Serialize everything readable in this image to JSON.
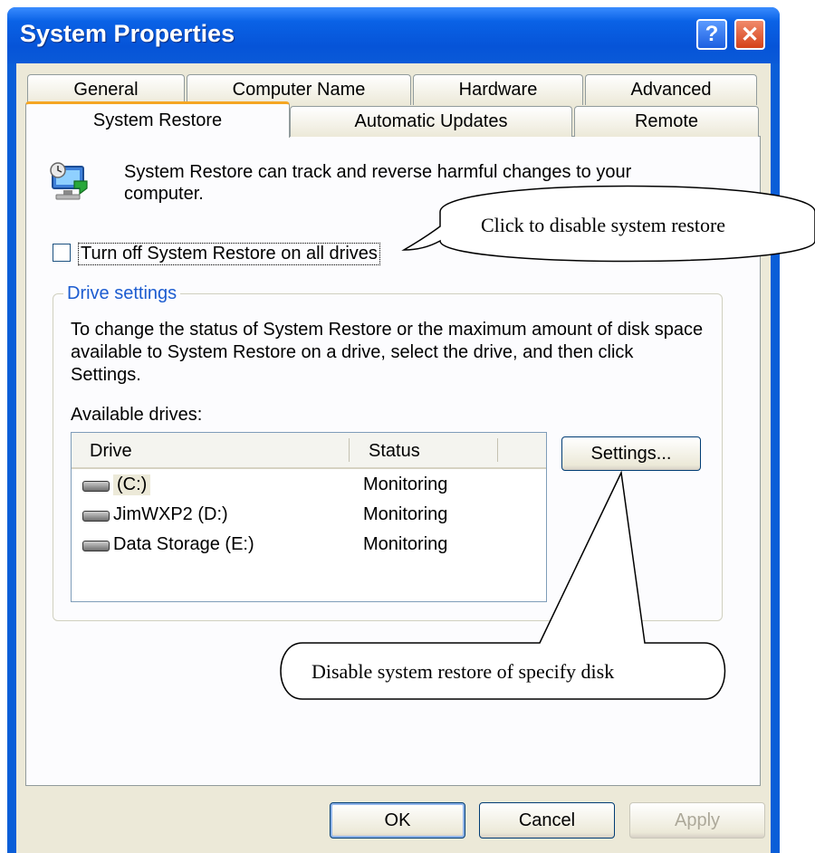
{
  "window": {
    "title": "System Properties",
    "help_glyph": "?",
    "close_glyph": "✕"
  },
  "tabs_row1": [
    "General",
    "Computer Name",
    "Hardware",
    "Advanced"
  ],
  "tabs_row2": [
    "System Restore",
    "Automatic Updates",
    "Remote"
  ],
  "active_tab": "System Restore",
  "intro_text": "System Restore can track and reverse harmful changes to your computer.",
  "turn_off_checkbox": {
    "label": "Turn off System Restore on all drives",
    "checked": false
  },
  "drive_settings": {
    "group_label": "Drive settings",
    "description": "To change the status of System Restore or the maximum amount of disk space available to System Restore on a drive, select the drive, and then click Settings.",
    "available_label": "Available drives:",
    "columns": [
      "Drive",
      "Status"
    ],
    "drives": [
      {
        "name": "(C:)",
        "status": "Monitoring",
        "selected": true
      },
      {
        "name": "JimWXP2 (D:)",
        "status": "Monitoring",
        "selected": false
      },
      {
        "name": "Data Storage (E:)",
        "status": "Monitoring",
        "selected": false
      }
    ],
    "settings_button": "Settings..."
  },
  "buttons": {
    "ok": "OK",
    "cancel": "Cancel",
    "apply": "Apply"
  },
  "annotations": {
    "callout_top": "Click to disable system restore",
    "callout_bottom": "Disable system restore of specify disk"
  }
}
